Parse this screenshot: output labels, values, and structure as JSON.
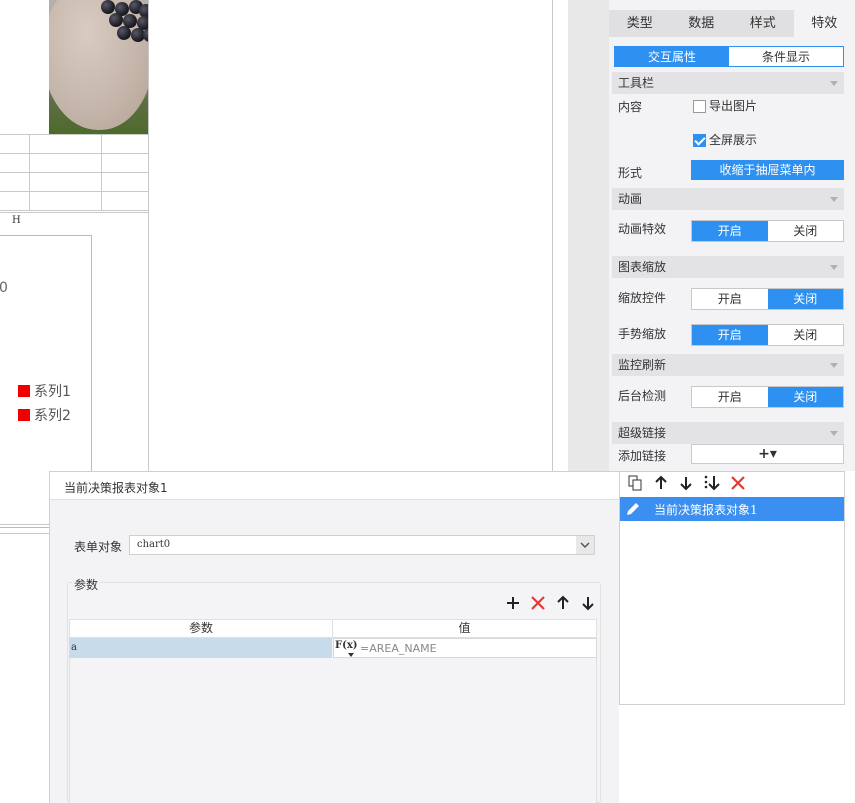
{
  "canvas": {
    "column_letter": "H",
    "chart_value_label": "0",
    "legend": [
      {
        "label": "系列1",
        "color": "#e00000"
      },
      {
        "label": "系列2",
        "color": "#e00000"
      }
    ]
  },
  "properties": {
    "tabs": [
      "类型",
      "数据",
      "样式",
      "特效"
    ],
    "active_tab": "特效",
    "subtabs": [
      "交互属性",
      "条件显示"
    ],
    "sections": {
      "toolbar": {
        "title": "工具栏",
        "content_label": "内容",
        "export_image": "导出图片",
        "export_image_checked": false,
        "fullscreen": "全屏展示",
        "fullscreen_checked": true,
        "form_label": "形式",
        "form_value": "收缩于抽屉菜单内"
      },
      "animation": {
        "title": "动画",
        "effect_label": "动画特效",
        "on": "开启",
        "off": "关闭",
        "selected": "开启"
      },
      "zoom": {
        "title": "图表缩放",
        "control_label": "缩放控件",
        "control_on": "开启",
        "control_off": "关闭",
        "control_selected": "关闭",
        "gesture_label": "手势缩放",
        "gesture_on": "开启",
        "gesture_off": "关闭",
        "gesture_selected": "开启"
      },
      "monitor": {
        "title": "监控刷新",
        "background_label": "后台检测",
        "on": "开启",
        "off": "关闭",
        "selected": "关闭"
      },
      "hyperlink": {
        "title": "超级链接",
        "add_label": "添加链接",
        "add_button": "+▾"
      }
    },
    "link_list": {
      "toolbar_icons": [
        "copy-icon",
        "arrow-up-icon",
        "arrow-down-icon",
        "sort-icon",
        "delete-icon"
      ],
      "items": [
        {
          "label": "当前决策报表对象1",
          "icon": "pencil-icon",
          "selected": true
        }
      ]
    }
  },
  "dialog": {
    "title": "当前决策报表对象1",
    "form_object_label": "表单对象",
    "form_object_value": "chart0",
    "params_title": "参数",
    "columns": [
      "参数",
      "值"
    ],
    "rows": [
      {
        "param": "a",
        "value": "=AREA_NAME"
      }
    ],
    "formula_icon_label": "F(x)"
  }
}
